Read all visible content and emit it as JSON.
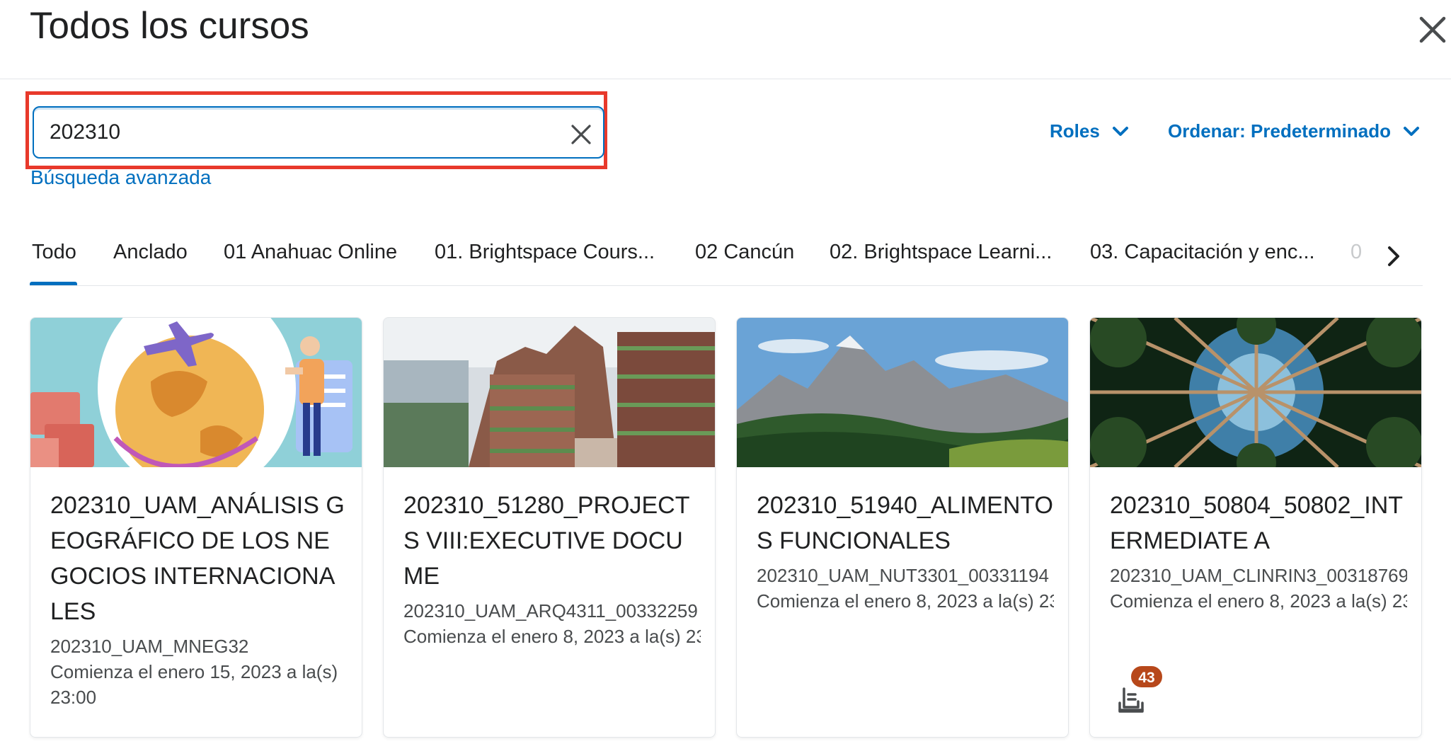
{
  "header": {
    "title": "Todos los cursos",
    "close_icon": "close-icon"
  },
  "search": {
    "value": "202310",
    "advanced_link": "Búsqueda avanzada",
    "clear_icon": "close-icon"
  },
  "filters": {
    "roles": "Roles",
    "sort": "Ordenar: Predeterminado"
  },
  "tabs": [
    {
      "label": "Todo",
      "active": true
    },
    {
      "label": "Anclado"
    },
    {
      "label": "01 Anahuac Online"
    },
    {
      "label": "01. Brightspace Cours..."
    },
    {
      "label": "02 Cancún"
    },
    {
      "label": "02. Brightspace Learni..."
    },
    {
      "label": "03. Capacitación y enc..."
    },
    {
      "label": "0"
    }
  ],
  "courses": [
    {
      "title": "202310_UAM_ANÁLISIS GEOGRÁFICO DE LOS NEGOCIOS INTERNACIONALES",
      "code": "202310_UAM_MNEG32",
      "date": "Comienza el enero 15, 2023 a la(s) 23:00"
    },
    {
      "title": "202310_51280_PROJECTS VIII:EXECUTIVE DOCUME",
      "code": "202310_UAM_ARQ4311_00332259",
      "date": "Comienza el enero 8, 2023 a la(s) 23"
    },
    {
      "title": "202310_51940_ALIMENTOS FUNCIONALES",
      "code": "202310_UAM_NUT3301_00331194",
      "date": "Comienza el enero 8, 2023 a la(s) 23"
    },
    {
      "title": "202310_50804_50802_INTERMEDIATE A",
      "code": "202310_UAM_CLINRIN3_00318769",
      "date": "Comienza el enero 8, 2023 a la(s) 23",
      "notification_count": "43"
    }
  ],
  "colors": {
    "accent": "#006fbf",
    "highlight": "#e8392b",
    "badge": "#b7481b"
  }
}
